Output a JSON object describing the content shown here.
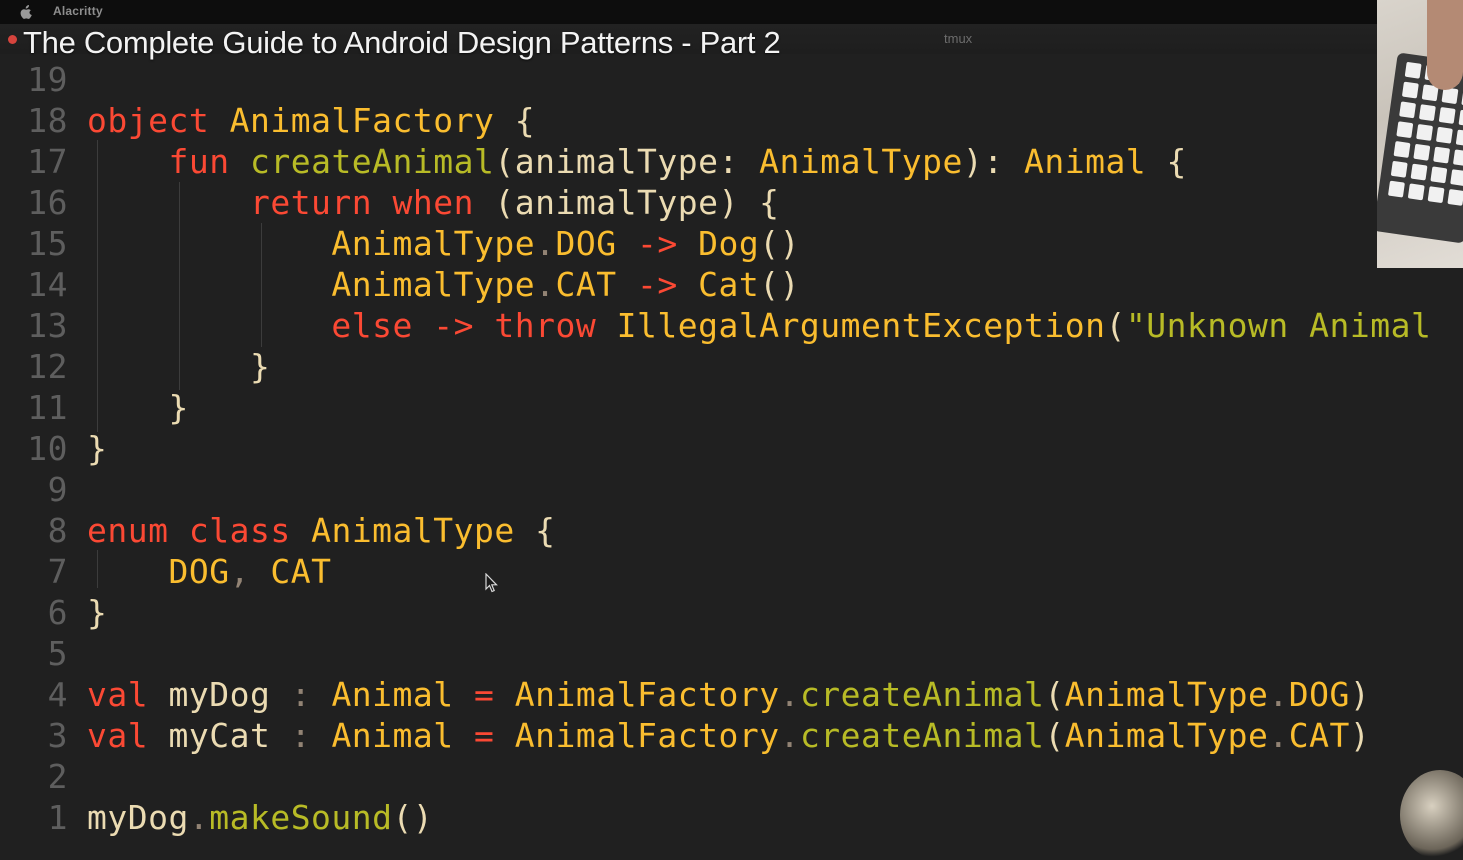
{
  "menubar": {
    "app_name": "Alacritty",
    "apple_icon": "apple-logo-icon"
  },
  "video": {
    "title": "The Complete Guide to Android Design Patterns - Part 2",
    "recording_indicator_color": "#d6443d"
  },
  "terminal": {
    "tab_label": "tmux"
  },
  "theme": {
    "background": "#202020",
    "keyword": "#fb4934",
    "type": "#fabd2f",
    "function": "#b8bb26",
    "text": "#ebdbb2",
    "line_number": "#5e5e5e"
  },
  "editor": {
    "lines": [
      {
        "num": "19",
        "tokens": []
      },
      {
        "num": "18",
        "tokens": [
          [
            "kw",
            "object"
          ],
          [
            "pu",
            " "
          ],
          [
            "ty",
            "AnimalFactory"
          ],
          [
            "pu",
            " {"
          ]
        ]
      },
      {
        "num": "17",
        "tokens": [
          [
            "pu",
            "    "
          ],
          [
            "kw",
            "fun"
          ],
          [
            "pu",
            " "
          ],
          [
            "fn",
            "createAnimal"
          ],
          [
            "pu",
            "(animalType: "
          ],
          [
            "ty",
            "AnimalType"
          ],
          [
            "pu",
            "): "
          ],
          [
            "ty",
            "Animal"
          ],
          [
            "pu",
            " {"
          ]
        ]
      },
      {
        "num": "16",
        "tokens": [
          [
            "pu",
            "        "
          ],
          [
            "kw",
            "return"
          ],
          [
            "pu",
            " "
          ],
          [
            "kw",
            "when"
          ],
          [
            "pu",
            " (animalType) {"
          ]
        ]
      },
      {
        "num": "15",
        "tokens": [
          [
            "pu",
            "            "
          ],
          [
            "ty",
            "AnimalType"
          ],
          [
            "dim",
            "."
          ],
          [
            "ty",
            "DOG"
          ],
          [
            "pu",
            " "
          ],
          [
            "kw",
            "->"
          ],
          [
            "pu",
            " "
          ],
          [
            "ty",
            "Dog"
          ],
          [
            "pu",
            "()"
          ]
        ]
      },
      {
        "num": "14",
        "tokens": [
          [
            "pu",
            "            "
          ],
          [
            "ty",
            "AnimalType"
          ],
          [
            "dim",
            "."
          ],
          [
            "ty",
            "CAT"
          ],
          [
            "pu",
            " "
          ],
          [
            "kw",
            "->"
          ],
          [
            "pu",
            " "
          ],
          [
            "ty",
            "Cat"
          ],
          [
            "pu",
            "()"
          ]
        ]
      },
      {
        "num": "13",
        "tokens": [
          [
            "pu",
            "            "
          ],
          [
            "kw",
            "else"
          ],
          [
            "pu",
            " "
          ],
          [
            "kw",
            "->"
          ],
          [
            "pu",
            " "
          ],
          [
            "kw",
            "throw"
          ],
          [
            "pu",
            " "
          ],
          [
            "ty",
            "IllegalArgumentException"
          ],
          [
            "pu",
            "("
          ],
          [
            "str",
            "\"Unknown Animal"
          ]
        ]
      },
      {
        "num": "12",
        "tokens": [
          [
            "pu",
            "        }"
          ]
        ]
      },
      {
        "num": "11",
        "tokens": [
          [
            "pu",
            "    }"
          ]
        ]
      },
      {
        "num": "10",
        "tokens": [
          [
            "pu",
            "}"
          ]
        ]
      },
      {
        "num": "9",
        "tokens": []
      },
      {
        "num": "8",
        "tokens": [
          [
            "kw",
            "enum"
          ],
          [
            "pu",
            " "
          ],
          [
            "kw",
            "class"
          ],
          [
            "pu",
            " "
          ],
          [
            "ty",
            "AnimalType"
          ],
          [
            "pu",
            " {"
          ]
        ]
      },
      {
        "num": "7",
        "tokens": [
          [
            "pu",
            "    "
          ],
          [
            "ty",
            "DOG"
          ],
          [
            "dim",
            ","
          ],
          [
            "pu",
            " "
          ],
          [
            "ty",
            "CAT"
          ]
        ]
      },
      {
        "num": "6",
        "tokens": [
          [
            "pu",
            "}"
          ]
        ]
      },
      {
        "num": "5",
        "tokens": []
      },
      {
        "num": "4",
        "tokens": [
          [
            "kw",
            "val"
          ],
          [
            "pu",
            " myDog "
          ],
          [
            "dim",
            ":"
          ],
          [
            "pu",
            " "
          ],
          [
            "ty",
            "Animal"
          ],
          [
            "pu",
            " "
          ],
          [
            "kw",
            "="
          ],
          [
            "pu",
            " "
          ],
          [
            "ty",
            "AnimalFactory"
          ],
          [
            "dim",
            "."
          ],
          [
            "fn",
            "createAnimal"
          ],
          [
            "pu",
            "("
          ],
          [
            "ty",
            "AnimalType"
          ],
          [
            "dim",
            "."
          ],
          [
            "ty",
            "DOG"
          ],
          [
            "pu",
            ")"
          ]
        ]
      },
      {
        "num": "3",
        "tokens": [
          [
            "kw",
            "val"
          ],
          [
            "pu",
            " myCat "
          ],
          [
            "dim",
            ":"
          ],
          [
            "pu",
            " "
          ],
          [
            "ty",
            "Animal"
          ],
          [
            "pu",
            " "
          ],
          [
            "kw",
            "="
          ],
          [
            "pu",
            " "
          ],
          [
            "ty",
            "AnimalFactory"
          ],
          [
            "dim",
            "."
          ],
          [
            "fn",
            "createAnimal"
          ],
          [
            "pu",
            "("
          ],
          [
            "ty",
            "AnimalType"
          ],
          [
            "dim",
            "."
          ],
          [
            "ty",
            "CAT"
          ],
          [
            "pu",
            ")"
          ]
        ]
      },
      {
        "num": "2",
        "tokens": []
      },
      {
        "num": "1",
        "tokens": [
          [
            "pu",
            "myDog"
          ],
          [
            "dim",
            "."
          ],
          [
            "fn",
            "makeSound"
          ],
          [
            "pu",
            "()"
          ]
        ]
      }
    ]
  }
}
